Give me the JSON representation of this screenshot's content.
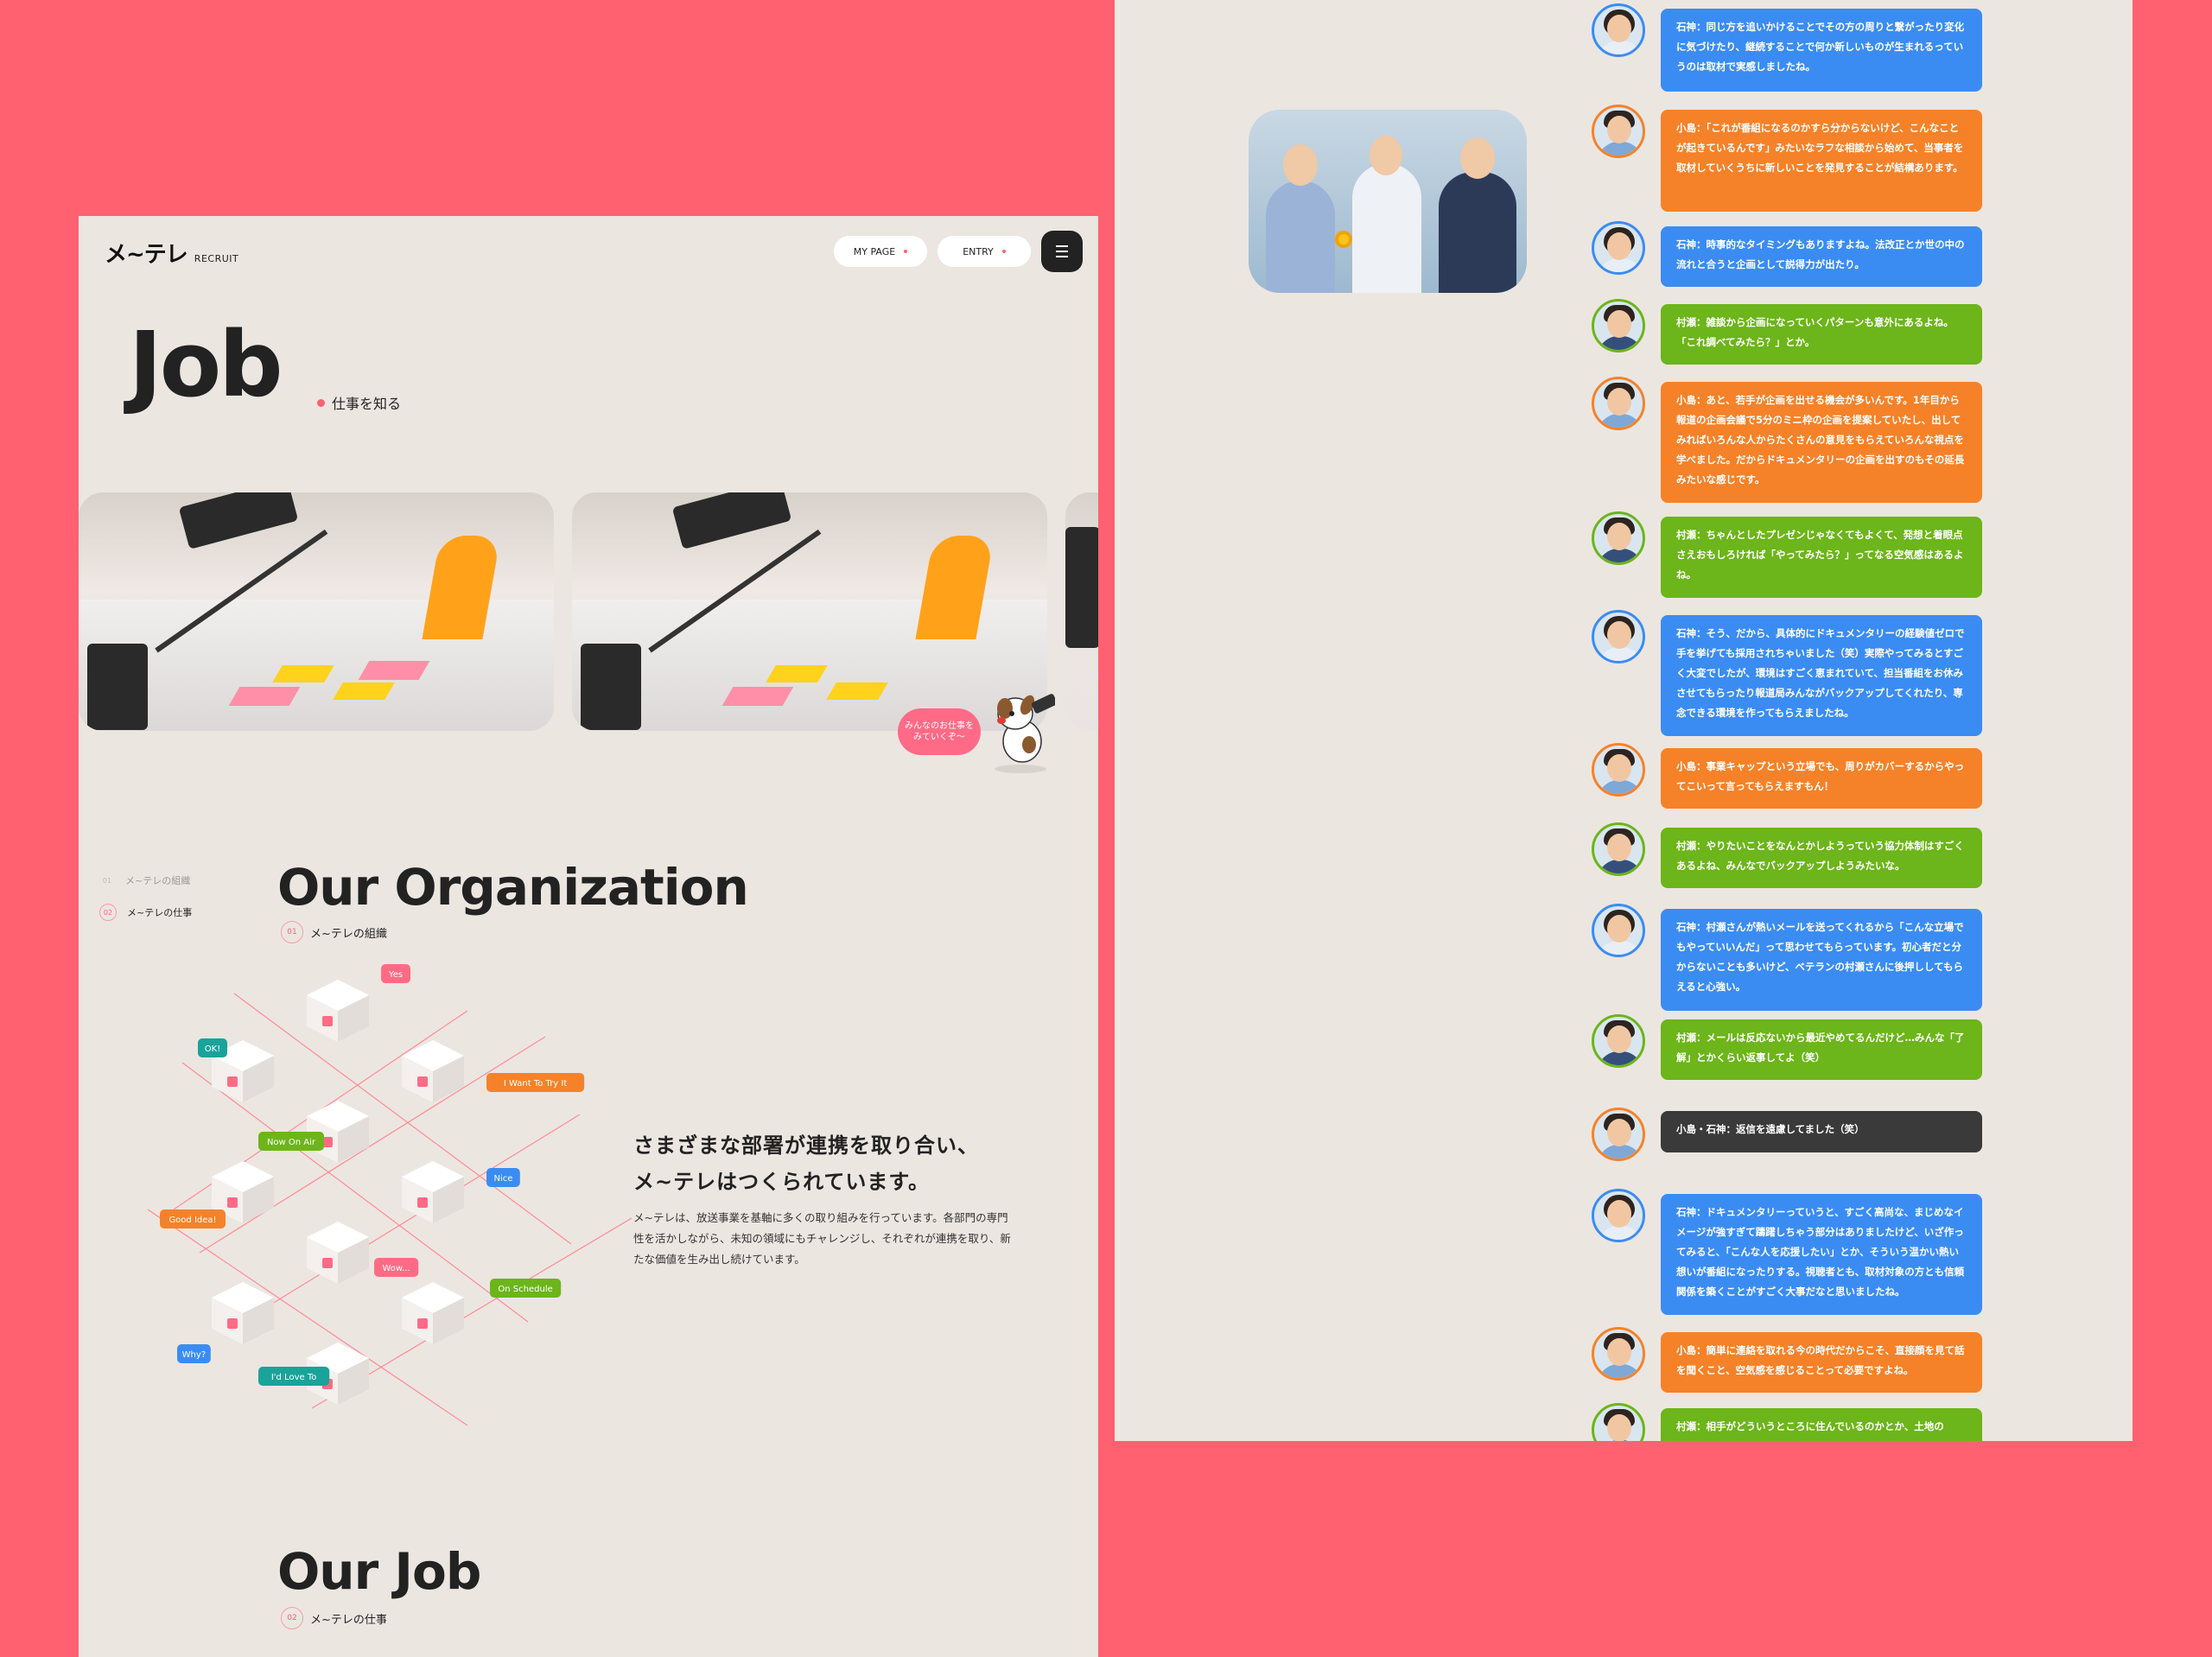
{
  "header": {
    "logo": "メ~テレ",
    "logo_sub": "RECRUIT",
    "my_page": "MY PAGE",
    "entry": "ENTRY"
  },
  "hero": {
    "title": "Job",
    "subtitle": "仕事を知る",
    "bubble": "みんなのお仕事を みていくぞ～"
  },
  "side_nav": [
    {
      "num": "01",
      "label": "メ~テレの組織"
    },
    {
      "num": "02",
      "label": "メ~テレの仕事"
    }
  ],
  "organization": {
    "title": "Our Organization",
    "num": "01",
    "sub": "メ~テレの組織",
    "lead_1": "さまざまな部署が連携を取り合い、",
    "lead_2": "メ~テレはつくられています。",
    "body": "メ~テレは、放送事業を基軸に多くの取り組みを行っています。各部門の専門性を活かしながら、未知の領域にもチャレンジし、それぞれが連携を取り、新たな価値を生み出し続けています。",
    "tags": [
      "Yes",
      "OK!",
      "I Want To Try It",
      "Now On Air",
      "Nice",
      "Good Idea!",
      "Wow...",
      "On Schedule",
      "Why?",
      "I'd Love To"
    ]
  },
  "job": {
    "title": "Our Job",
    "num": "02",
    "sub": "メ~テレの仕事"
  },
  "colors": {
    "background": "#ff6170",
    "panel": "#ece6e1",
    "blue": "#3b8cf2",
    "orange": "#f58229",
    "green": "#6cb51a",
    "dark": "#3a3a3a"
  },
  "chat": [
    {
      "speaker": "ishigami",
      "color": "blue",
      "text": "石神：同じ方を追いかけることでその方の周りと繋がったり変化に気づけたり、継続することで何か新しいものが生まれるっていうのは取材で実感しましたね。"
    },
    {
      "speaker": "kojima",
      "color": "orange",
      "text": "小島：「これが番組になるのかすら分からないけど、こんなことが起きているんです」みたいなラフな相談から始めて、当事者を取材していくうちに新しいことを発見することが結構あります。"
    },
    {
      "speaker": "ishigami",
      "color": "blue",
      "text": "石神：時事的なタイミングもありますよね。法改正とか世の中の流れと合うと企画として説得力が出たり。"
    },
    {
      "speaker": "murase",
      "color": "green",
      "text": "村瀬：雑談から企画になっていくパターンも意外にあるよね。「これ調べてみたら？」とか。"
    },
    {
      "speaker": "kojima",
      "color": "orange",
      "text": "小島：あと、若手が企画を出せる機会が多いんです。1年目から報道の企画会議で5分のミニ枠の企画を提案していたし、出してみればいろんな人からたくさんの意見をもらえていろんな視点を学べました。だからドキュメンタリーの企画を出すのもその延長みたいな感じです。"
    },
    {
      "speaker": "murase",
      "color": "green",
      "text": "村瀬：ちゃんとしたプレゼンじゃなくてもよくて、発想と着眼点さえおもしろければ「やってみたら？」ってなる空気感はあるよね。"
    },
    {
      "speaker": "ishigami",
      "color": "blue",
      "text": "石神：そう、だから、具体的にドキュメンタリーの経験値ゼロで手を挙げても採用されちゃいました（笑）実際やってみるとすごく大変でしたが、環境はすごく恵まれていて、担当番組をお休みさせてもらったり報道局みんながバックアップしてくれたり、専念できる環境を作ってもらえましたね。"
    },
    {
      "speaker": "kojima",
      "color": "orange",
      "text": "小島：事業キャップという立場でも、周りがカバーするからやってこいって言ってもらえますもん！"
    },
    {
      "speaker": "murase",
      "color": "green",
      "text": "村瀬：やりたいことをなんとかしようっていう協力体制はすごくあるよね、みんなでバックアップしようみたいな。"
    },
    {
      "speaker": "ishigami",
      "color": "blue",
      "text": "石神：村瀬さんが熱いメールを送ってくれるから「こんな立場でもやっていいんだ」って思わせてもらっています。初心者だと分からないことも多いけど、ベテランの村瀬さんに後押ししてもらえると心強い。"
    },
    {
      "speaker": "murase",
      "color": "green",
      "text": "村瀬：メールは反応ないから最近やめてるんだけど…みんな「了解」とかくらい返事してよ（笑）"
    },
    {
      "speaker": "both",
      "color": "dark",
      "text": "小島・石神：返信を遠慮してました（笑）"
    },
    {
      "speaker": "ishigami",
      "color": "blue",
      "text": "石神：ドキュメンタリーっていうと、すごく高尚な、まじめなイメージが強すぎて躊躇しちゃう部分はありましたけど、いざ作ってみると、「こんな人を応援したい」とか、そういう温かい熱い想いが番組になったりする。視聴者とも、取材対象の方とも信頼関係を築くことがすごく大事だなと思いましたね。"
    },
    {
      "speaker": "kojima",
      "color": "orange",
      "text": "小島：簡単に連絡を取れる今の時代だからこそ、直接顔を見て話を聞くこと、空気感を感じることって必要ですよね。"
    },
    {
      "speaker": "murase",
      "color": "green",
      "text": "村瀬：相手がどういうところに住んでいるのかとか、土地の"
    }
  ]
}
